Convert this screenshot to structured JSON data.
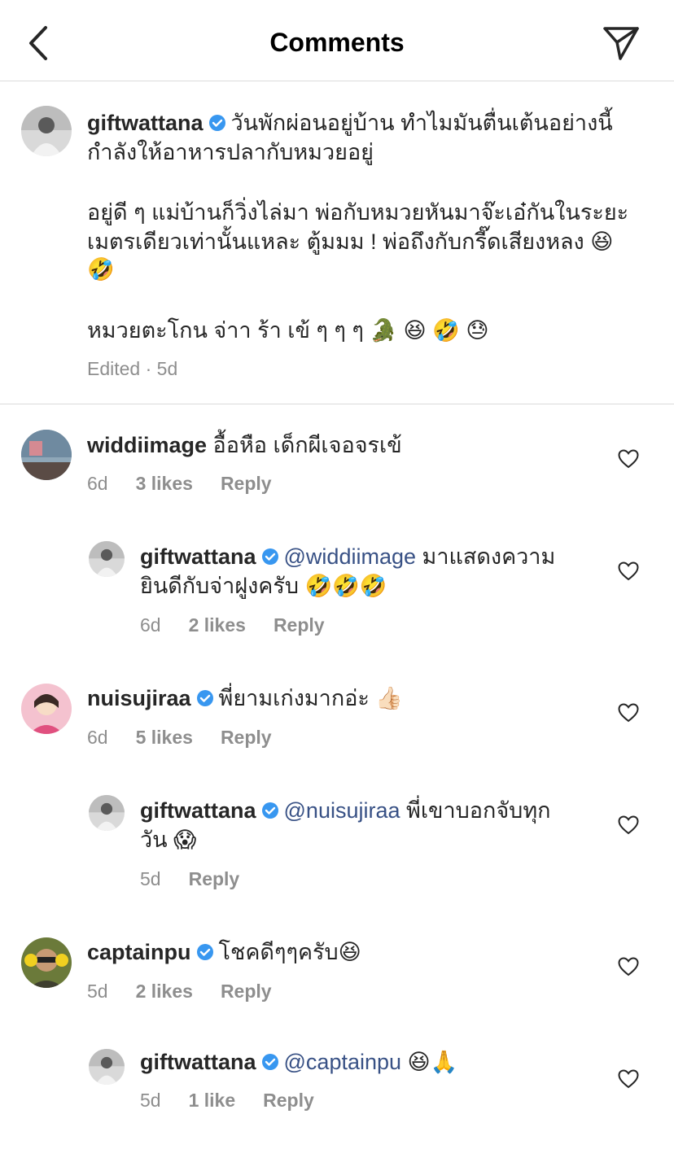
{
  "header": {
    "title": "Comments"
  },
  "caption": {
    "username": "giftwattana",
    "line1": "วันพักผ่อนอยู่บ้าน ทำไมมันตื่นเต้นอย่างนี้",
    "line2": "กำลังให้อาหารปลากับหมวยอยู่",
    "line3": "อยู่ดี ๆ แม่บ้านก็วิ่งไล่มา พ่อกับหมวยหันมาจ๊ะเอ๋กันในระยะ",
    "line4": "เมตรเดียวเท่านั้นแหละ ตู้มมม ! พ่อถึงกับกรี๊ดเสียงหลง 😆",
    "line5": "🤣",
    "line6": "หมวยตะโกน จ่าา ร้า เข้ ๆ ๆ ๆ 🐊 😆 🤣 😓",
    "meta": "Edited · 5d"
  },
  "comments": [
    {
      "username": "widdiimage",
      "text": "อื้อหือ เด็กผีเจอจรเข้",
      "time": "6d",
      "likes": "3 likes",
      "reply": "Reply"
    },
    {
      "username": "giftwattana",
      "mention": "@widdiimage",
      "text": "มาแสดงความ",
      "text2": "ยินดีกับจ่าฝูงครับ 🤣🤣🤣",
      "time": "6d",
      "likes": "2 likes",
      "reply": "Reply"
    },
    {
      "username": "nuisujiraa",
      "text": "พี่ยามเก่งมากอ่ะ 👍🏻",
      "time": "6d",
      "likes": "5 likes",
      "reply": "Reply"
    },
    {
      "username": "giftwattana",
      "mention": "@nuisujiraa",
      "text": "พี่เขาบอกจับทุก",
      "text2": "วัน 😱",
      "time": "5d",
      "reply": "Reply"
    },
    {
      "username": "captainpu",
      "text": "โชคดีๆๆครับ😆",
      "time": "5d",
      "likes": "2 likes",
      "reply": "Reply"
    },
    {
      "username": "giftwattana",
      "mention": "@captainpu",
      "text": "😆🙏",
      "time": "5d",
      "likes": "1 like",
      "reply": "Reply"
    }
  ],
  "colors": {
    "verified": "#3897f0",
    "mention": "#385185",
    "meta": "#8e8e8e",
    "divider": "#dbdbdb"
  },
  "icons": [
    "chevron-left-icon",
    "send-icon",
    "verified-badge-icon",
    "heart-icon"
  ]
}
